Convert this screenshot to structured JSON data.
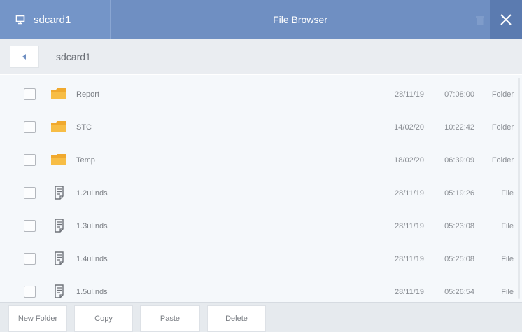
{
  "header": {
    "device_label": "sdcard1",
    "title": "File Browser"
  },
  "pathbar": {
    "current_path": "sdcard1"
  },
  "files": [
    {
      "name": "Report",
      "date": "28/11/19",
      "time": "07:08:00",
      "type": "Folder",
      "icon": "folder-icon"
    },
    {
      "name": "STC",
      "date": "14/02/20",
      "time": "10:22:42",
      "type": "Folder",
      "icon": "folder-icon"
    },
    {
      "name": "Temp",
      "date": "18/02/20",
      "time": "06:39:09",
      "type": "Folder",
      "icon": "folder-icon"
    },
    {
      "name": "1.2ul.nds",
      "date": "28/11/19",
      "time": "05:19:26",
      "type": "File",
      "icon": "file-icon"
    },
    {
      "name": "1.3ul.nds",
      "date": "28/11/19",
      "time": "05:23:08",
      "type": "File",
      "icon": "file-icon"
    },
    {
      "name": "1.4ul.nds",
      "date": "28/11/19",
      "time": "05:25:08",
      "type": "File",
      "icon": "file-icon"
    },
    {
      "name": "1.5ul.nds",
      "date": "28/11/19",
      "time": "05:26:54",
      "type": "File",
      "icon": "file-icon"
    }
  ],
  "toolbar": {
    "new_folder": "New Folder",
    "copy": "Copy",
    "paste": "Paste",
    "delete": "Delete"
  },
  "colors": {
    "header_bg": "#6f8fc2",
    "folder": "#f5b63c",
    "list_bg": "#f5f8fb"
  }
}
